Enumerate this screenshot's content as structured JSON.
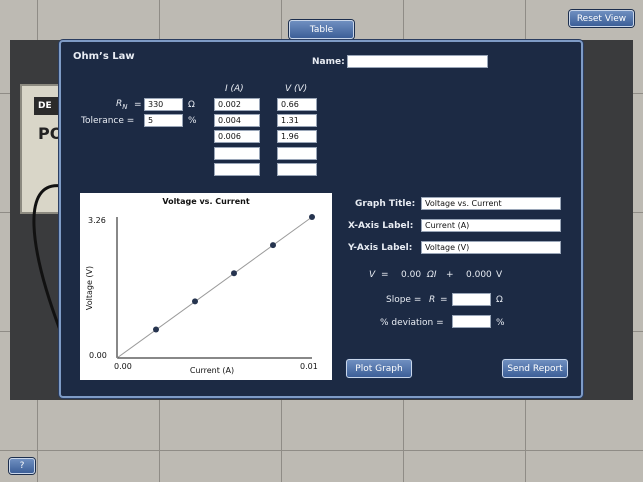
{
  "tab": {
    "label": "Table"
  },
  "top_button": {
    "label": "Reset View"
  },
  "help_button": {
    "label": "?"
  },
  "device": {
    "tag": "DE",
    "text": "PO"
  },
  "panel": {
    "title": "Ohm’s Law",
    "name_label": "Name:",
    "name_value": "",
    "rn_label": "R",
    "rn_subscript": "N",
    "rn_eq": "=",
    "rn_value": "330",
    "rn_unit": "Ω",
    "tol_label": "Tolerance =",
    "tol_value": "5",
    "tol_unit": "%",
    "col_i": "I (A)",
    "col_v": "V (V)",
    "rows": [
      {
        "i": "0.002",
        "v": "0.66"
      },
      {
        "i": "0.004",
        "v": "1.31"
      },
      {
        "i": "0.006",
        "v": "1.96"
      },
      {
        "i": "",
        "v": ""
      },
      {
        "i": "",
        "v": ""
      }
    ],
    "graph_title_label": "Graph Title:",
    "graph_title_value": "Voltage vs. Current",
    "x_axis_label": "X-Axis Label:",
    "x_axis_value": "Current (A)",
    "y_axis_label": "Y-Axis Label:",
    "y_axis_value": "Voltage (V)",
    "equation": {
      "v": "V",
      "eq": "=",
      "slope": "0.00",
      "omega_i": "ΩI",
      "plus": "+",
      "intercept": "0.000",
      "unit": "V"
    },
    "slope_label": "Slope =",
    "slope_r": "R",
    "slope_eq": "=",
    "slope_value": "",
    "slope_unit": "Ω",
    "dev_label": "% deviation =",
    "dev_value": "",
    "dev_unit": "%",
    "plot_button": "Plot Graph",
    "send_button": "Send Report"
  },
  "chart_data": {
    "type": "scatter",
    "title": "Voltage vs. Current",
    "xlabel": "Current (A)",
    "ylabel": "Voltage (V)",
    "xlim": [
      0.0,
      0.01
    ],
    "ylim": [
      0.0,
      3.26
    ],
    "x_tick_labels": [
      "0.00",
      "0.01"
    ],
    "y_tick_labels": [
      "0.00",
      "3.26"
    ],
    "fit_line": {
      "x": [
        0.0,
        0.01
      ],
      "y": [
        0.0,
        3.26
      ]
    },
    "points": [
      {
        "x": 0.002,
        "y": 0.66
      },
      {
        "x": 0.004,
        "y": 1.31
      },
      {
        "x": 0.006,
        "y": 1.96
      },
      {
        "x": 0.008,
        "y": 2.61
      },
      {
        "x": 0.01,
        "y": 3.26
      }
    ]
  }
}
